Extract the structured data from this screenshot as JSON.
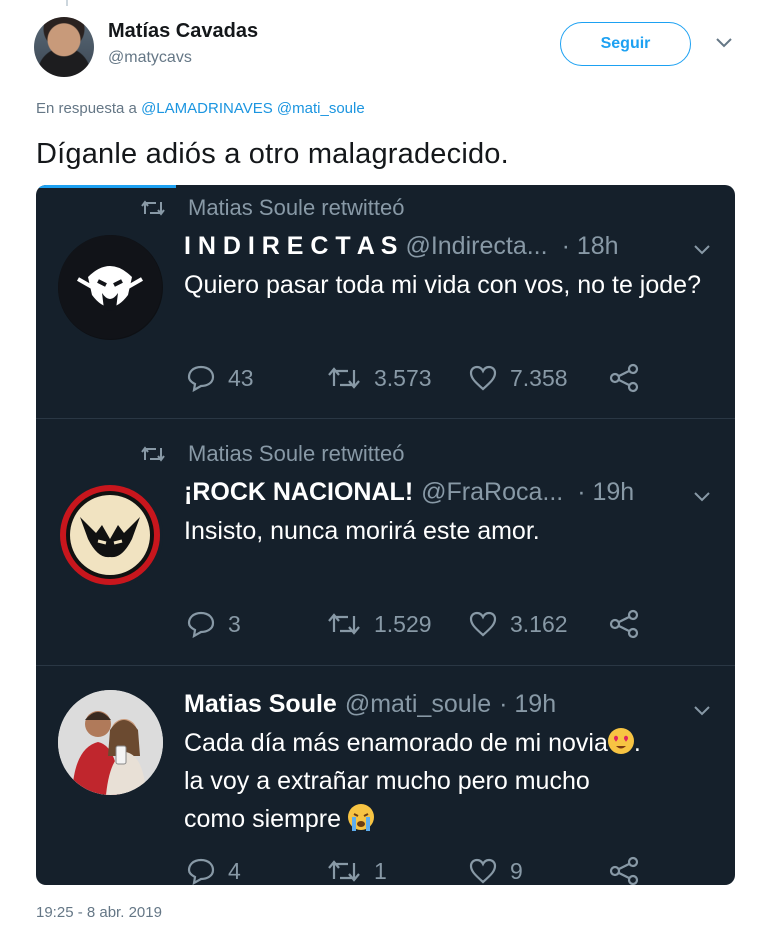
{
  "author": {
    "name": "Matías Cavadas",
    "handle": "@matycavs",
    "follow_label": "Seguir"
  },
  "reply": {
    "prefix": "En respuesta a",
    "mention1": "@LAMADRINAVES",
    "mention2": "@mati_soule"
  },
  "tweet": {
    "text": "Díganle adiós a otro malagradecido.",
    "timestamp": "19:25 - 8 abr. 2019"
  },
  "embed": {
    "cards": [
      {
        "retweeted_by": "Matias Soule retwitteó",
        "name": "I N D I R E C T A S",
        "handle": "@Indirecta...",
        "time": "· 18h",
        "text": "Quiero pasar toda mi vida con vos, no te jode?",
        "replies": "43",
        "retweets": "3.573",
        "likes": "7.358"
      },
      {
        "retweeted_by": "Matias Soule retwitteó",
        "name": "¡ROCK NACIONAL!",
        "handle": "@FraRoca...",
        "time": "· 19h",
        "text": "Insisto, nunca morirá este amor.",
        "replies": "3",
        "retweets": "1.529",
        "likes": "3.162"
      },
      {
        "name": "Matias Soule",
        "handle": "@mati_soule",
        "time": "· 19h",
        "text_line1": "Cada día más enamorado de mi novia",
        "text_line2": "la voy a extrañar mucho pero mucho",
        "text_line3": "como siempre",
        "replies": "4",
        "retweets": "1",
        "likes": "9"
      }
    ]
  },
  "colors": {
    "accent": "#1da1f2",
    "dark_bg": "#15202b",
    "muted": "#8899a6"
  }
}
